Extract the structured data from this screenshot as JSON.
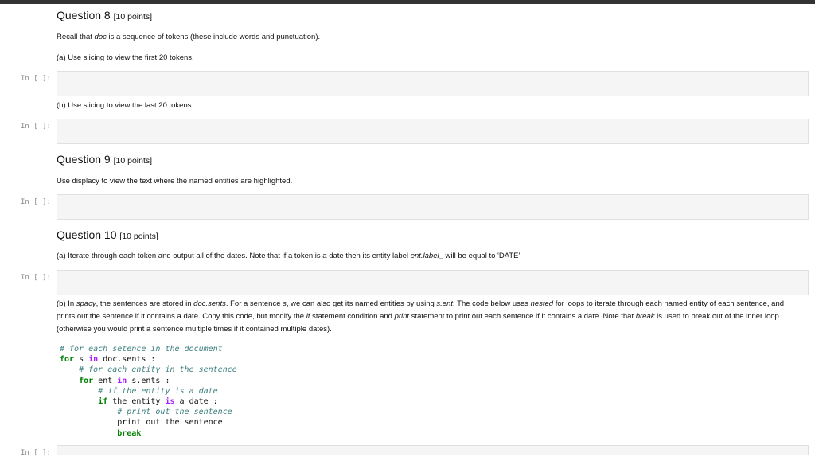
{
  "q8": {
    "title": "Question 8",
    "points": "[10 points]",
    "intro_a": "Recall that ",
    "intro_doc": "doc",
    "intro_b": " is a sequence of tokens (these include words and punctuation).",
    "part_a": "(a) Use slicing to view the first 20 tokens.",
    "part_b": "(b) Use slicing to view the last 20 tokens."
  },
  "q9": {
    "title": "Question 9",
    "points": "[10 points]",
    "instruction": "Use displacy to view the text where the named entities are highlighted."
  },
  "q10": {
    "title": "Question 10",
    "points": "[10 points]",
    "part_a_1": "(a) Iterate through each token and output all of the dates. Note that if a token is a date then its entity label ",
    "part_a_label": "ent.label_",
    "part_a_2": " will be equal to 'DATE'",
    "pb_1": "(b) In ",
    "pb_spacy": "spacy",
    "pb_2": ", the sentences are stored in ",
    "pb_docsents": "doc.sents",
    "pb_3": ". For a sentence ",
    "pb_s": "s",
    "pb_4": ", we can also get its named entities by using ",
    "pb_sent": "s.ent",
    "pb_5": ". The code below uses ",
    "pb_nested": "nested",
    "pb_6": " for loops to iterate through each named entity of each sentence, and prints out the sentence if it contains a date. Copy this code, but modify the ",
    "pb_if": "if",
    "pb_7": " statement condition and ",
    "pb_print": "print",
    "pb_8": " statement to print out each sentence if it contains a date. Note that ",
    "pb_break": "break",
    "pb_9": " is used to break out of the inner loop (otherwise you would print a sentence multiple times if it contained multiple dates).",
    "code": {
      "c1": "# for each setence in the document",
      "kw_for": "for",
      "l2a": " s ",
      "kw_in": "in",
      "l2b": " doc.sents :",
      "c2": "# for each entity in the sentence",
      "l4a": " ent ",
      "l4b": " s.ents :",
      "c3": "# if the entity is a date",
      "kw_if": "if",
      "l6a": " the entity ",
      "kw_is": "is",
      "l6b": " a date :",
      "c4": "# print out the sentence",
      "l8": "print out the sentence",
      "kw_break": "break"
    }
  },
  "prompts": {
    "cell_prompt": "In [ ]:"
  }
}
